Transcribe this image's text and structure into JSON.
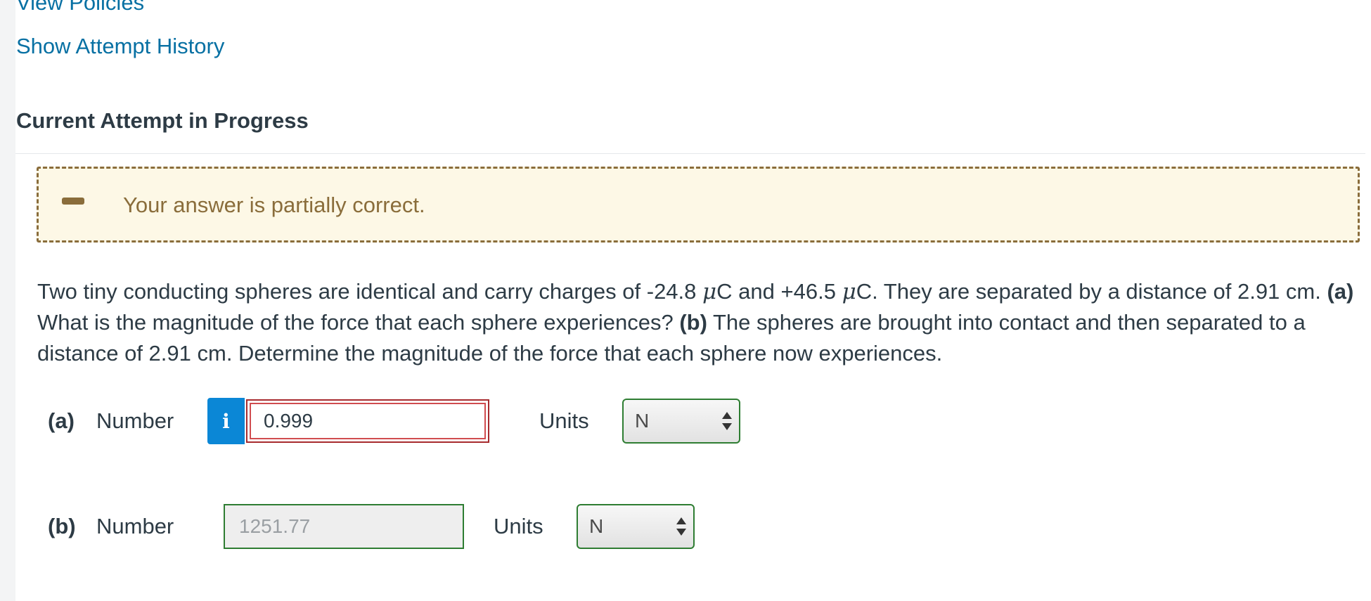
{
  "links": {
    "view_policies": "View Policies",
    "attempt_history": "Show Attempt History"
  },
  "section_title": "Current Attempt in Progress",
  "feedback": {
    "message": "Your answer is partially correct.",
    "icon": "minus-icon",
    "color": "#8a6d3b",
    "background": "#fdf8e6"
  },
  "question": {
    "t1": "Two tiny conducting spheres are identical and carry charges of -24.8 ",
    "mu": "μ",
    "t2": "C and +46.5 ",
    "t3": "C. They are separated by a distance of 2.91 cm. ",
    "a_marker": "(a)",
    "t4": " What is the magnitude of the force that each sphere experiences? ",
    "b_marker": "(b)",
    "t5": " The spheres are brought into contact and then separated to a distance of 2.91 cm. Determine the magnitude of the force that each sphere now experiences."
  },
  "parts": {
    "a": {
      "label": "(a)",
      "number_label": "Number",
      "info_icon": "i",
      "value": "0.999",
      "units_label": "Units",
      "unit": "N",
      "status": "incorrect"
    },
    "b": {
      "label": "(b)",
      "number_label": "Number",
      "value": "1251.77",
      "units_label": "Units",
      "unit": "N",
      "status": "correct"
    }
  },
  "colors": {
    "link": "#0770a3",
    "info_button": "#0b87d6",
    "incorrect_border": "#a72b2e",
    "correct_border": "#2e7d32"
  }
}
